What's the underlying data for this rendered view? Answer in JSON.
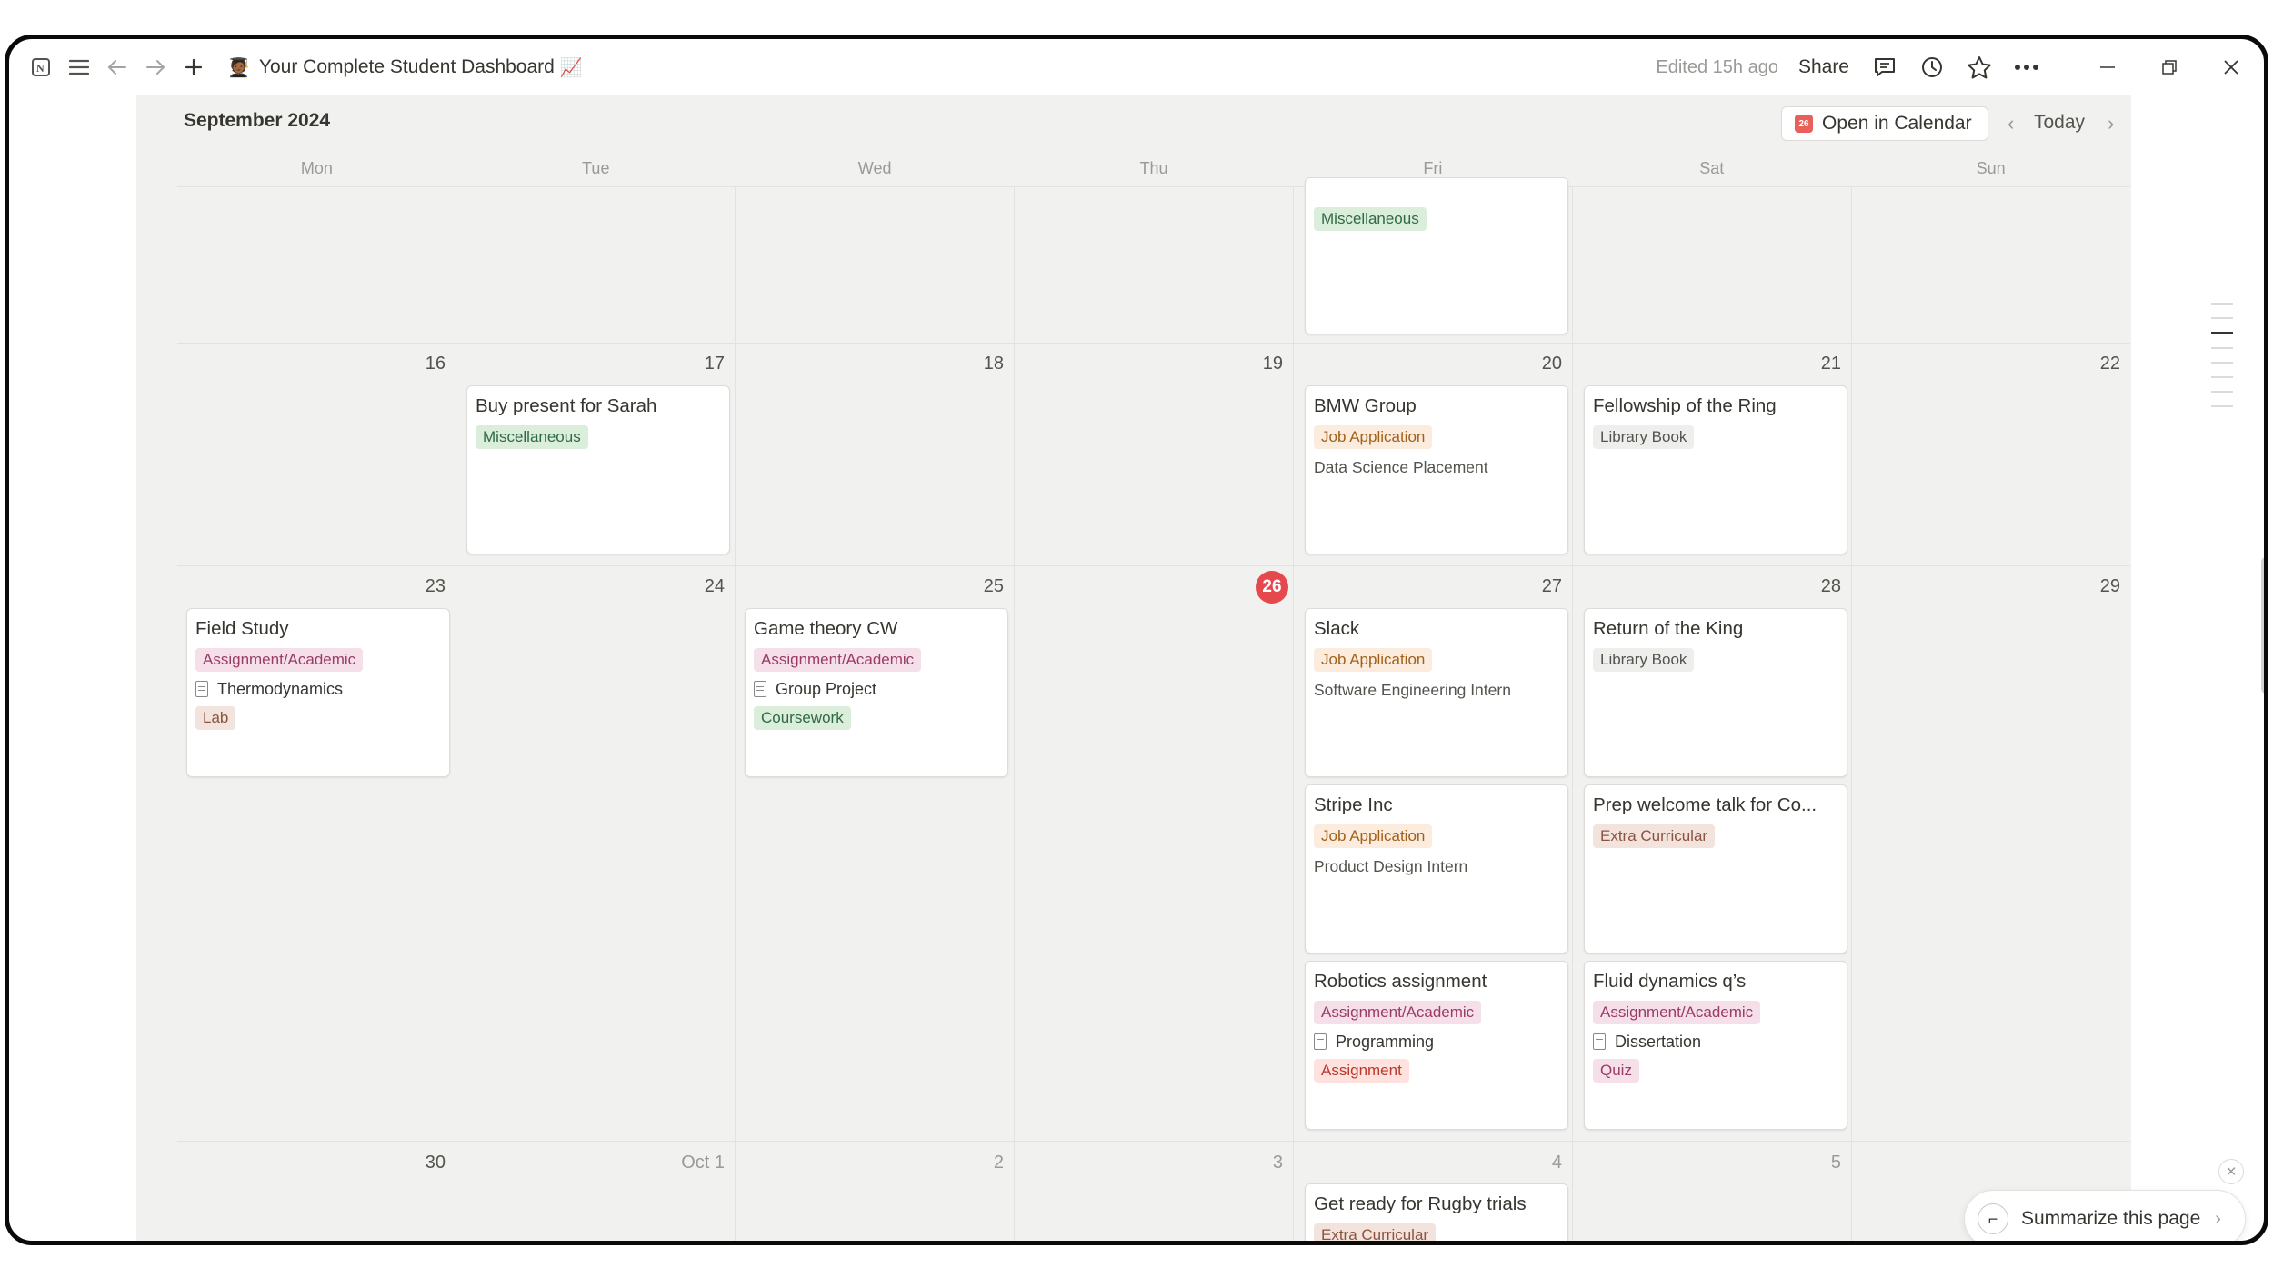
{
  "topbar": {
    "page_emoji": "🧑🏾‍🎓",
    "page_title": "Your Complete Student Dashboard",
    "title_emoji": "📈",
    "edited": "Edited 15h ago",
    "share": "Share"
  },
  "calendar": {
    "month": "September 2024",
    "open_in_calendar": "Open in Calendar",
    "calendar_icon_text": "26",
    "today": "Today",
    "weekdays": [
      "Mon",
      "Tue",
      "Wed",
      "Thu",
      "Fri",
      "Sat",
      "Sun"
    ],
    "row1": {
      "fri_card_tag": "Miscellaneous"
    },
    "row2": {
      "days": [
        "16",
        "17",
        "18",
        "19",
        "20",
        "21",
        "22"
      ],
      "cards": {
        "tue": {
          "title": "Buy present for Sarah",
          "tag": "Miscellaneous"
        },
        "fri": {
          "title": "BMW Group",
          "tag": "Job Application",
          "text": "Data Science Placement"
        },
        "sat": {
          "title": "Fellowship of the Ring",
          "tag": "Library Book"
        }
      }
    },
    "row3": {
      "days": [
        "23",
        "24",
        "25",
        "26",
        "27",
        "28",
        "29"
      ],
      "cards": {
        "mon": {
          "title": "Field Study",
          "tag": "Assignment/Academic",
          "relation": "Thermodynamics",
          "tag2": "Lab"
        },
        "wed": {
          "title": "Game theory CW",
          "tag": "Assignment/Academic",
          "relation": "Group Project",
          "tag2": "Coursework"
        },
        "fri1": {
          "title": "Slack",
          "tag": "Job Application",
          "text": "Software Engineering Intern"
        },
        "fri2": {
          "title": "Stripe Inc",
          "tag": "Job Application",
          "text": "Product Design Intern"
        },
        "fri3": {
          "title": "Robotics assignment",
          "tag": "Assignment/Academic",
          "relation": "Programming",
          "tag2": "Assignment"
        },
        "sat1": {
          "title": "Return of the King",
          "tag": "Library Book"
        },
        "sat2": {
          "title": "Prep welcome talk for Co...",
          "tag": "Extra Curricular"
        },
        "sat3": {
          "title": "Fluid dynamics q’s",
          "tag": "Assignment/Academic",
          "relation": "Dissertation",
          "tag2": "Quiz"
        }
      }
    },
    "row4": {
      "days": [
        "30",
        "Oct 1",
        "2",
        "3",
        "4",
        "5"
      ],
      "cards": {
        "fri": {
          "title": "Get ready for Rugby trials",
          "tag": "Extra Curricular"
        }
      }
    }
  },
  "summarize": {
    "label": "Summarize this page"
  },
  "colors": {
    "today_accent": "#e5484d",
    "calendar_bg": "#f1f1ef"
  }
}
